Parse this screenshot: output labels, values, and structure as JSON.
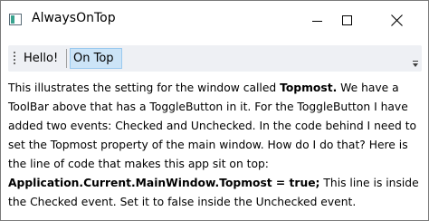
{
  "window": {
    "title": "AlwaysOnTop",
    "icon": "wpf-app-icon",
    "controls": {
      "minimize": "minimize-icon",
      "maximize": "maximize-icon",
      "close": "close-icon"
    }
  },
  "toolbar": {
    "hello_label": "Hello!",
    "ontop_label": "On Top",
    "ontop_checked": true,
    "overflow_icon": "toolbar-overflow-icon"
  },
  "body": {
    "p1": "This illustrates the setting for the window called ",
    "b1": "Topmost.",
    "p2": " We have a ToolBar above that has a ToggleButton in it. For the ToggleButton I have added two events: Checked and Unchecked. In the code behind I need to set the Topmost property of the main window. How do I do that? Here is the line of code that makes this app sit on top: ",
    "b2": "Application.Current.MainWindow.Topmost = true;",
    "p3": " This line is inside the Checked event. Set it to false inside the Unchecked event."
  },
  "colors": {
    "toolbar_background": "#eef0f4",
    "toggle_checked_fill": "#cce4f7",
    "toggle_checked_border": "#99c9ef",
    "icon_accent": "#39a38f"
  }
}
